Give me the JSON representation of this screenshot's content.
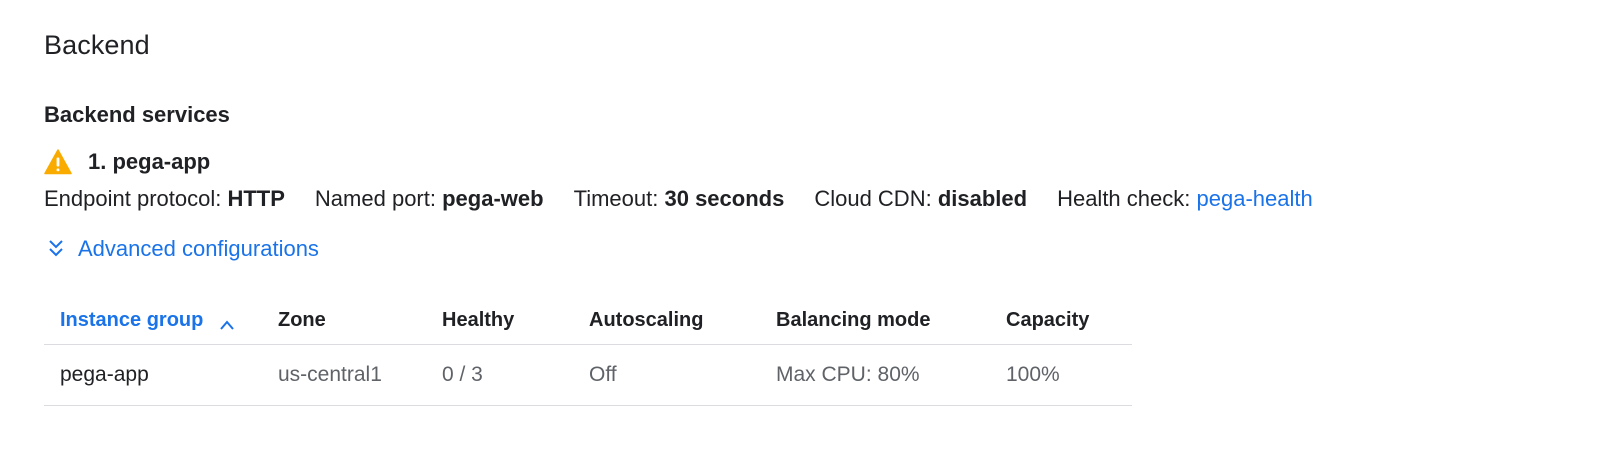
{
  "section": {
    "title": "Backend"
  },
  "backend_services": {
    "heading": "Backend services",
    "service": {
      "name": "1. pega-app",
      "status_icon": "warning-icon",
      "status_color": "#f9ab00",
      "endpoint_protocol_label": "Endpoint protocol:",
      "endpoint_protocol_value": "HTTP",
      "named_port_label": "Named port:",
      "named_port_value": "pega-web",
      "timeout_label": "Timeout:",
      "timeout_value": "30 seconds",
      "cloud_cdn_label": "Cloud CDN:",
      "cloud_cdn_value": "disabled",
      "health_check_label": "Health check:",
      "health_check_value": "pega-health"
    },
    "advanced_config_label": "Advanced configurations"
  },
  "table": {
    "columns": {
      "instance_group": "Instance group",
      "zone": "Zone",
      "healthy": "Healthy",
      "autoscaling": "Autoscaling",
      "balancing_mode": "Balancing mode",
      "capacity": "Capacity"
    },
    "sort_column": "instance_group",
    "sort_direction": "ascending",
    "rows": [
      {
        "instance_group": "pega-app",
        "zone": "us-central1",
        "healthy": "0 / 3",
        "autoscaling": "Off",
        "balancing_mode": "Max CPU: 80%",
        "capacity": "100%"
      }
    ]
  },
  "colors": {
    "link": "#1a73e8",
    "text_primary": "#202124",
    "text_secondary": "#5f6368",
    "divider": "#dadce0",
    "warning": "#f9ab00"
  }
}
